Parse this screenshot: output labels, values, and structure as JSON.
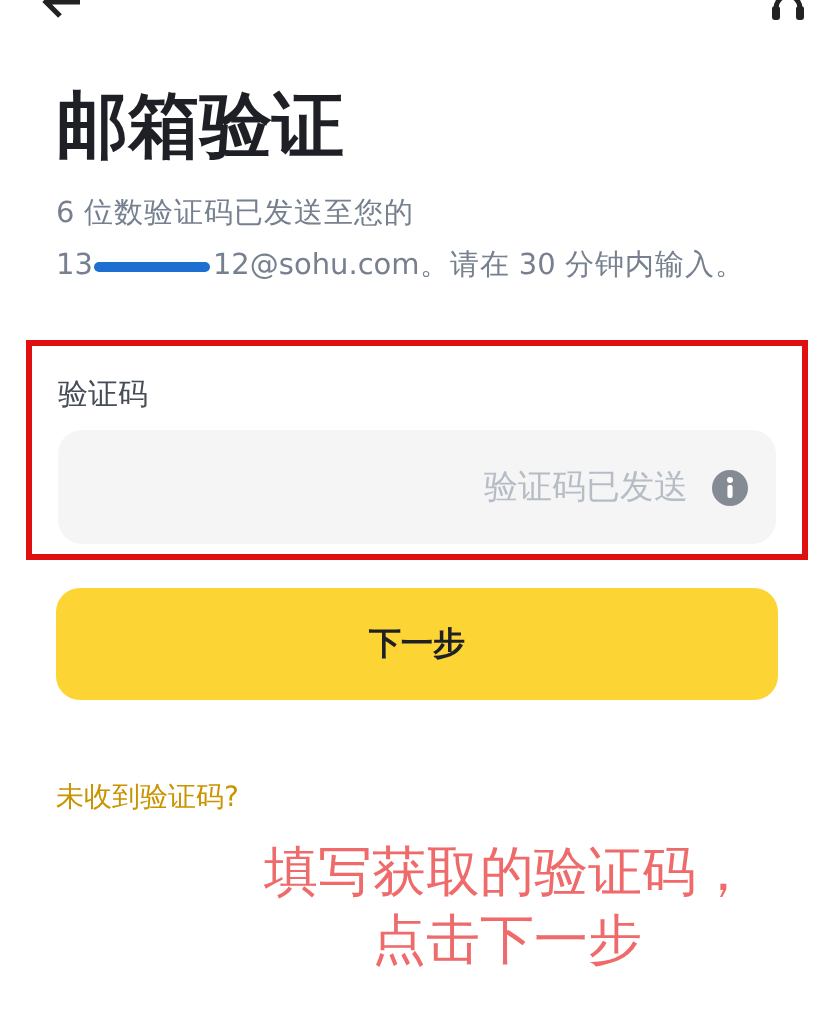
{
  "title": "邮箱验证",
  "description_line": "6 位数验证码已发送至您的",
  "email_start": "13",
  "email_rest": "12@sohu.com。请在 30 分钟内输入。",
  "code_field": {
    "label": "验证码",
    "placeholder": "验证码已发送"
  },
  "next_button": "下一步",
  "resend_link": "未收到验证码?",
  "annotation": [
    "填写获取的验证码，",
    "点击下一步"
  ]
}
